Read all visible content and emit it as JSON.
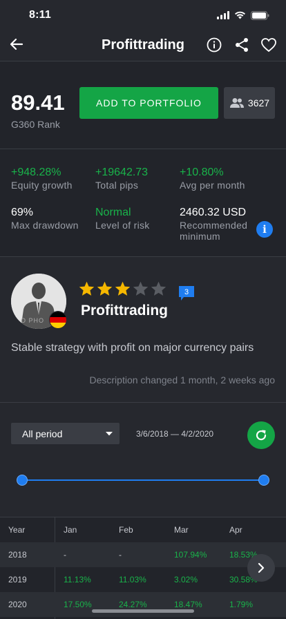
{
  "status_bar": {
    "time": "8:11"
  },
  "header": {
    "title": "Profittrading"
  },
  "rank": {
    "value": "89.41",
    "label": "G360 Rank",
    "add_button": "ADD TO PORTFOLIO",
    "followers": "3627"
  },
  "stats": [
    {
      "value": "+948.28%",
      "label": "Equity growth",
      "color": "#19b34a"
    },
    {
      "value": "+19642.73",
      "label": "Total pips",
      "color": "#19b34a"
    },
    {
      "value": "+10.80%",
      "label": "Avg per month",
      "color": "#19b34a"
    },
    {
      "value": "69%",
      "label": "Max drawdown",
      "color": "#ffffff"
    },
    {
      "value": "Normal",
      "label": "Level of risk",
      "color": "#19b34a"
    },
    {
      "value": "2460.32 USD",
      "label": "Recommended",
      "label2": "minimum",
      "color": "#ffffff"
    }
  ],
  "profile": {
    "name": "Profittrading",
    "rating": 3,
    "rating_max": 5,
    "comments": "3",
    "description": "Stable strategy with profit on major currency pairs",
    "description_changed": "Description changed 1 month, 2 weeks ago",
    "avatar_watermark": "O PHO",
    "flag": "germany-flag"
  },
  "filter": {
    "period": "All period",
    "date_range": "3/6/2018 — 4/2/2020",
    "slider_from": 0,
    "slider_to": 1
  },
  "table": {
    "headers": [
      "Year",
      "Jan",
      "Feb",
      "Mar",
      "Apr"
    ],
    "rows": [
      {
        "year": "2018",
        "values": [
          "-",
          "-",
          "107.94%",
          "18.53%"
        ]
      },
      {
        "year": "2019",
        "values": [
          "11.13%",
          "11.03%",
          "3.02%",
          "30.58%"
        ]
      },
      {
        "year": "2020",
        "values": [
          "17.50%",
          "24.27%",
          "18.47%",
          "1.79%"
        ]
      }
    ]
  },
  "colors": {
    "accent_green": "#14a546",
    "positive": "#19b34a",
    "accent_blue": "#1f7df0",
    "star": "#f5b700",
    "star_empty": "#5a5d63"
  }
}
